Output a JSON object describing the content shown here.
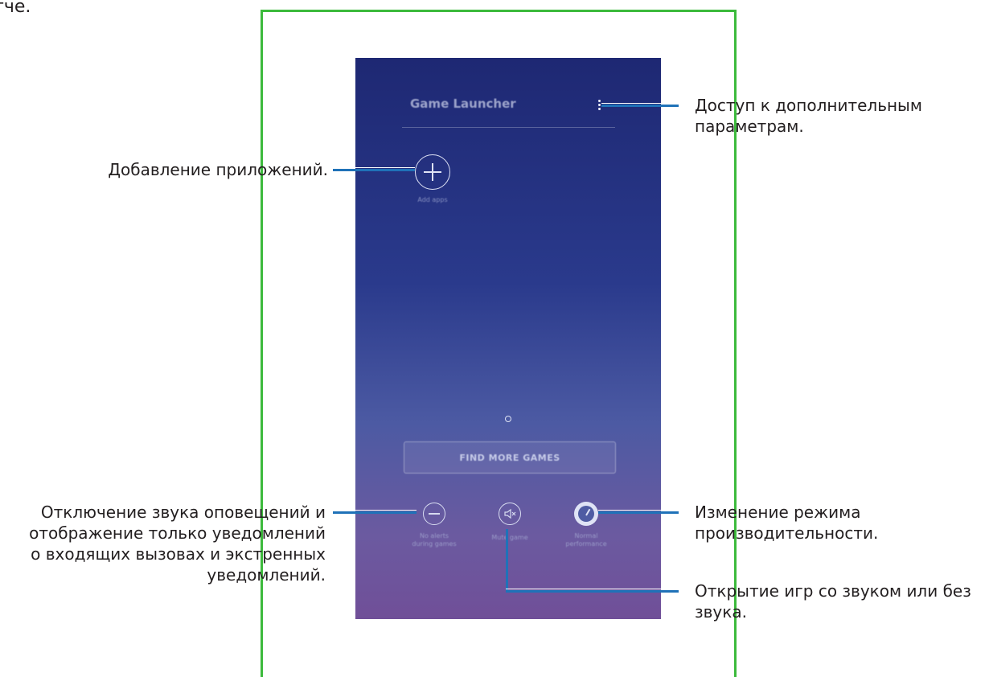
{
  "page": {
    "fragment_text": "тче."
  },
  "phone": {
    "app_title": "Game Launcher",
    "add_apps_label": "Add apps",
    "find_more_games": "FIND MORE GAMES",
    "no_alerts_label_line1": "No alerts",
    "no_alerts_label_line2": "during games",
    "mute_game_label": "Mute game",
    "performance_label_line1": "Normal",
    "performance_label_line2": "performance"
  },
  "callouts": {
    "more_options": [
      "Доступ к дополнительным",
      "параметрам."
    ],
    "add_apps": "Добавление приложений.",
    "no_alerts": [
      "Отключение звука оповещений и",
      "отображение только уведомлений",
      "о входящих вызовах и экстренных",
      "уведомлений."
    ],
    "performance": [
      "Изменение режима",
      "производительности."
    ],
    "mute_game": [
      "Открытие игр со звуком или без",
      "звука."
    ]
  },
  "colors": {
    "frame": "#3cba3c",
    "callout_line": "#1f72b8",
    "phone_top": "#1e2873",
    "phone_bottom": "#704f98"
  }
}
